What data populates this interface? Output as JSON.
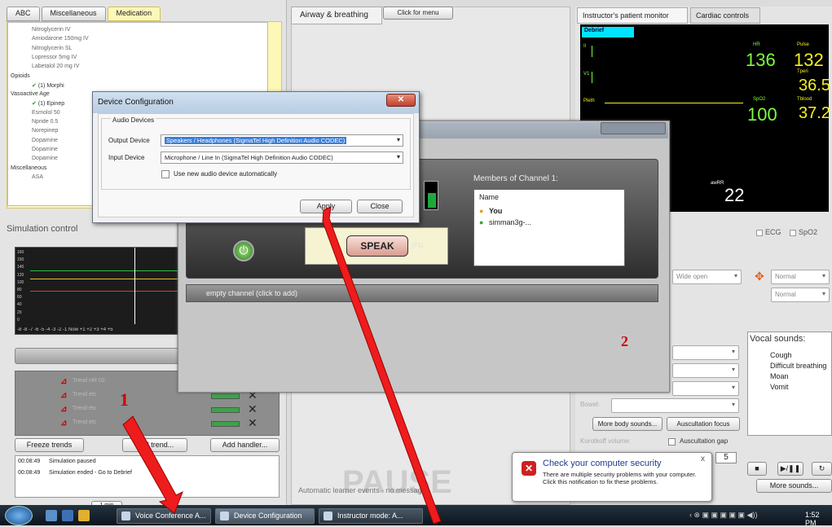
{
  "left_panel": {
    "tabs": [
      "ABC",
      "Miscellaneous",
      "Medication"
    ],
    "meds": [
      {
        "label": "Nitroglycerin IV",
        "type": "item"
      },
      {
        "label": "Amiodarone 150mg IV",
        "type": "item"
      },
      {
        "label": "Nitroglycerin SL",
        "type": "item"
      },
      {
        "label": "Lopressor 5mg IV",
        "type": "item"
      },
      {
        "label": "Labetalol 20 mg IV",
        "type": "item"
      },
      {
        "label": "Opioids",
        "type": "folder"
      },
      {
        "label": "(1) Morphi",
        "type": "checked"
      },
      {
        "label": "Vasoactive Age",
        "type": "folder"
      },
      {
        "label": "(1) Epinep",
        "type": "checked"
      },
      {
        "label": "Esmolol 50",
        "type": "item"
      },
      {
        "label": "Npride 0.5",
        "type": "item"
      },
      {
        "label": "Norepinep",
        "type": "item"
      },
      {
        "label": "Dopamine",
        "type": "item"
      },
      {
        "label": "Dopamine",
        "type": "item"
      },
      {
        "label": "Dopamine",
        "type": "item"
      },
      {
        "label": "Miscellaneous",
        "type": "folder"
      },
      {
        "label": "ASA",
        "type": "item"
      }
    ],
    "sim_control_title": "Simulation control",
    "trend_y_labels": [
      "160",
      "150",
      "140",
      "120",
      "100",
      "80",
      "60",
      "40",
      "20",
      "0"
    ],
    "trend_x_labels": "-8 -8 -7 -6 -5 -4 -3 -2 -1 Now +1 +2 +3 +4 +5",
    "trends": [
      {
        "label": "Trend HR 02"
      },
      {
        "label": "Trend etc"
      },
      {
        "label": "Trend etc"
      },
      {
        "label": "Trend etc"
      }
    ],
    "trend_remove": "✕",
    "buttons": {
      "freeze": "Freeze trends",
      "add_trend": "Add trend...",
      "add_handler": "Add handler..."
    },
    "events": [
      {
        "time": "00:08:49",
        "text": "Simulation paused"
      },
      {
        "time": "00:08:49",
        "text": "Simulation ended - Go to Debrief"
      }
    ],
    "interval": "1 min"
  },
  "center_panel": {
    "tab": "Airway & breathing",
    "menu_button": "Click for menu",
    "pause_text": "PAUSE",
    "auto_learner": "Automatic learner events - no message"
  },
  "right_panel": {
    "tab1": "Instructor's patient monitor",
    "tab2": "Cardiac controls",
    "debrief": "Debrief",
    "vitals": {
      "hr": "136",
      "pulse": "132",
      "tperi": "36.5",
      "spo2": "100",
      "tblood": "37.2",
      "awrr": "22"
    },
    "vital_labels": {
      "hr": "HR",
      "pulse": "Pulse",
      "tperi": "Tperi",
      "spo2": "SpO2",
      "tblood": "Tblood",
      "awrr": "awRR",
      "pleth": "Pleth",
      "ii": "II",
      "v1": "V1"
    },
    "ecg": "ECG",
    "spo2opt": "SpO2",
    "selects": {
      "wide_open": "Wide open",
      "normal1": "Normal",
      "normal2": "Normal"
    },
    "vocal_title": "Vocal sounds:",
    "vocal_items": [
      "Cough",
      "Difficult breathing",
      "Moan",
      "Vomit"
    ],
    "bowel": "Bowel:",
    "more_body": "More body sounds...",
    "ausc_focus": "Auscultation focus",
    "korotkoff": "Korotkoff volume:",
    "ausc_gap": "Auscultation gap",
    "gap_value": "5",
    "more_sounds": "More sounds..."
  },
  "voice_window": {
    "members_title": "Members of Channel 1:",
    "members_header": "Name",
    "members": [
      "You",
      "simman3g-..."
    ],
    "speak": "SPEAK",
    "speak_key": "(F5)",
    "empty_channel": "empty channel (click to add)"
  },
  "device_dialog": {
    "title": "Device Configuration",
    "group": "Audio Devices",
    "output_label": "Output Device",
    "output_value": "Speakers / Headphones (SigmaTel High Definition Audio CODEC)",
    "input_label": "Input Device",
    "input_value": "Microphone / Line In (SigmaTel High Definition Audio CODEC)",
    "auto_checkbox": "Use new audio device automatically",
    "apply": "Apply",
    "close": "Close",
    "close_x": "✕"
  },
  "annotations": {
    "label1": "1",
    "label2": "2"
  },
  "balloon": {
    "title": "Check your computer security",
    "text": "There are multiple security problems with your computer. Click this notification to fix these problems.",
    "close": "x"
  },
  "taskbar": {
    "tasks": [
      "Voice Conference A...",
      "Device Configuration",
      "Instructor mode: A..."
    ],
    "clock": "1:52 PM"
  },
  "colors": {
    "arrow": "#ee1c1c",
    "medication_bg": "#fdf7b8",
    "monitor_green": "#7cff3a",
    "monitor_yellow": "#f5f020"
  }
}
